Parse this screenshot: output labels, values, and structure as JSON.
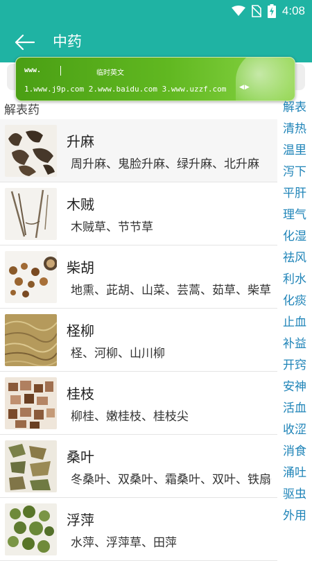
{
  "status_bar": {
    "time": "4:08",
    "icons": [
      "wifi-icon",
      "no-sim-icon",
      "battery-charging-icon"
    ]
  },
  "app_bar": {
    "title": "中药",
    "back_icon": "arrow-left-icon"
  },
  "ime_popup": {
    "input_text": "www.",
    "mode_label": "临时英文",
    "candidates": "1.www.j9p.com  2.www.baidu.com  3.www.uzzf.com",
    "page_arrows": "◀▶"
  },
  "section": {
    "title": "解表药"
  },
  "items": [
    {
      "name": "升麻",
      "alias": "周升麻、鬼脸升麻、绿升麻、北升麻"
    },
    {
      "name": "木贼",
      "alias": "木贼草、节节草"
    },
    {
      "name": "柴胡",
      "alias": "地熏、茈胡、山菜、芸蒿、茹草、柴草"
    },
    {
      "name": "柽柳",
      "alias": "柽、河柳、山川柳"
    },
    {
      "name": "桂枝",
      "alias": "柳桂、嫩桂枝、桂枝尖"
    },
    {
      "name": "桑叶",
      "alias": "冬桑叶、双桑叶、霜桑叶、双叶、铁扇子"
    },
    {
      "name": "浮萍",
      "alias": "水萍、浮萍草、田萍"
    }
  ],
  "index": [
    "解表",
    "清热",
    "温里",
    "泻下",
    "平肝",
    "理气",
    "化湿",
    "祛风",
    "利水",
    "化痰",
    "止血",
    "补益",
    "开窍",
    "安神",
    "活血",
    "收涩",
    "消食",
    "涌吐",
    "驱虫",
    "外用"
  ],
  "colors": {
    "primary": "#1fb3a3",
    "index_text": "#1f84b8",
    "ime_green": "#5db31e"
  }
}
